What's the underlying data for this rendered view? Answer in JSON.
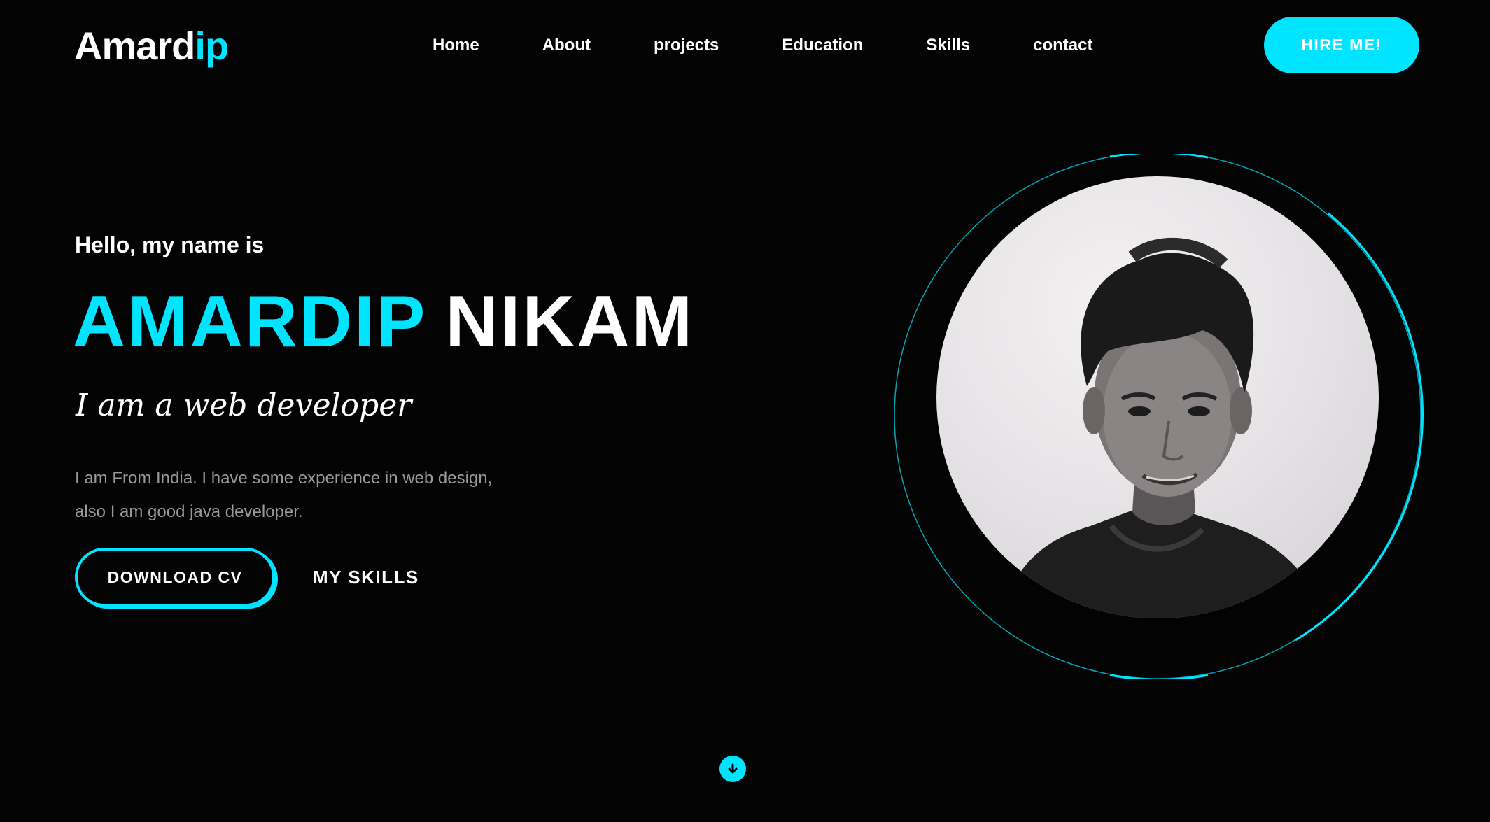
{
  "brand": {
    "logo_main": "Amard",
    "logo_accent": "ip"
  },
  "nav": {
    "items": [
      {
        "label": "Home"
      },
      {
        "label": "About"
      },
      {
        "label": "projects"
      },
      {
        "label": "Education"
      },
      {
        "label": "Skills"
      },
      {
        "label": "contact"
      }
    ],
    "cta_label": "HIRE ME!"
  },
  "hero": {
    "greeting": "Hello, my name is",
    "first_name": "AMARDIP",
    "last_name": "NIKAM",
    "tagline": "I am a web developer",
    "bio_line_1": "I am From India. I have some experience in web design,",
    "bio_line_2": "also I am good java developer.",
    "primary_button": "DOWNLOAD CV",
    "secondary_button": "MY SKILLS"
  },
  "profile_photo": {
    "description_icon": "profile-photo"
  },
  "scroll": {
    "icon": "arrow-down-icon"
  },
  "theme": {
    "accent": "#00e5ff",
    "background": "#030303",
    "text": "#ffffff",
    "muted_text": "#9a9a9a"
  }
}
